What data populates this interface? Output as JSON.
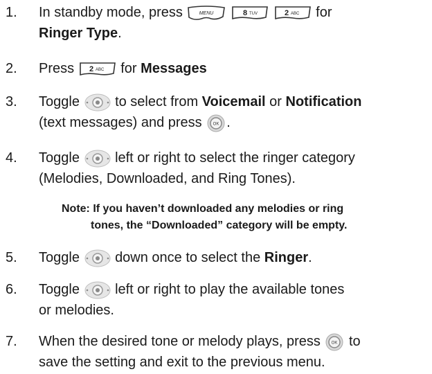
{
  "steps": [
    {
      "num": "1.",
      "pre": "In standby mode, press",
      "mid": "for",
      "bold": "Ringer Type",
      "post": ".",
      "keys": [
        "MENU",
        "8 TUV",
        "2 ABC"
      ]
    },
    {
      "num": "2.",
      "pre": "Press",
      "post": "for",
      "bold": "Messages",
      "keys": [
        "2 ABC"
      ]
    },
    {
      "num": "3.",
      "a": "Toggle",
      "b": "to select from",
      "bold1": "Voicemail",
      "c": "or",
      "bold2": "Notification",
      "d": "(text messages) and press",
      "e": "."
    },
    {
      "num": "4.",
      "a": "Toggle",
      "b": "left or right to select the ringer category",
      "c": "(Melodies, Downloaded, and Ring Tones)."
    },
    {
      "num": "5.",
      "a": "Toggle",
      "b": "down once to select the",
      "bold": "Ringer",
      "c": "."
    },
    {
      "num": "6.",
      "a": "Toggle",
      "b": "left or right to play the available tones",
      "c": "or melodies."
    },
    {
      "num": "7.",
      "a": "When the desired tone or melody plays, press",
      "b": "to",
      "c": "save the setting and exit to the previous menu."
    }
  ],
  "note": {
    "line1": "Note: If you haven’t downloaded any melodies or ring",
    "line2": "tones, the “Downloaded” category will be empty."
  },
  "keys": {
    "menu": "MENU",
    "eight_num": "8",
    "eight_letters": "TUV",
    "two_num": "2",
    "two_letters": "ABC",
    "ok": "OK"
  }
}
